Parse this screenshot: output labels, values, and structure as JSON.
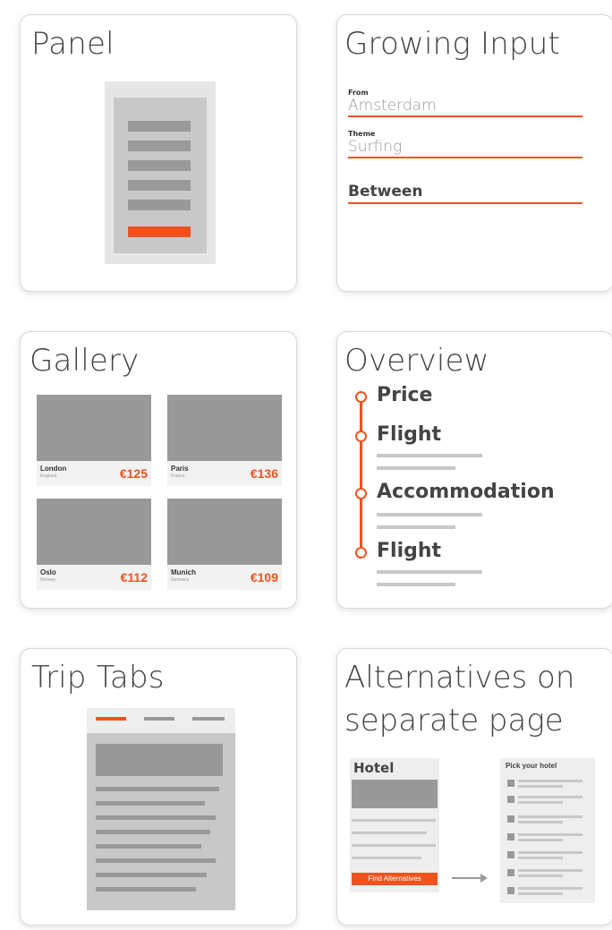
{
  "cards": {
    "panel": {
      "title": "Panel"
    },
    "growing_input": {
      "title": "Growing Input",
      "fields": [
        {
          "label": "From",
          "value": "Amsterdam"
        },
        {
          "label": "Theme",
          "value": "Surfing"
        },
        {
          "label": "",
          "value": "Between"
        }
      ]
    },
    "gallery": {
      "title": "Gallery",
      "tiles": [
        {
          "city": "London",
          "country": "England",
          "price": "€125"
        },
        {
          "city": "Paris",
          "country": "France",
          "price": "€136"
        },
        {
          "city": "Oslo",
          "country": "Norway",
          "price": "€112"
        },
        {
          "city": "Munich",
          "country": "Germany",
          "price": "€109"
        }
      ]
    },
    "overview": {
      "title": "Overview",
      "items": [
        "Price",
        "Flight",
        "Accommodation",
        "Flight"
      ]
    },
    "trip_tabs": {
      "title": "Trip Tabs"
    },
    "alternatives": {
      "title_line1": "Alternatives on",
      "title_line2": "separate page",
      "hotel_title": "Hotel",
      "find_button": "Find Alternatives",
      "pick_title": "Pick your hotel"
    }
  },
  "colors": {
    "accent": "#f0521e",
    "placeholder_gray": "#999999",
    "light_gray": "#c8c8c8"
  }
}
